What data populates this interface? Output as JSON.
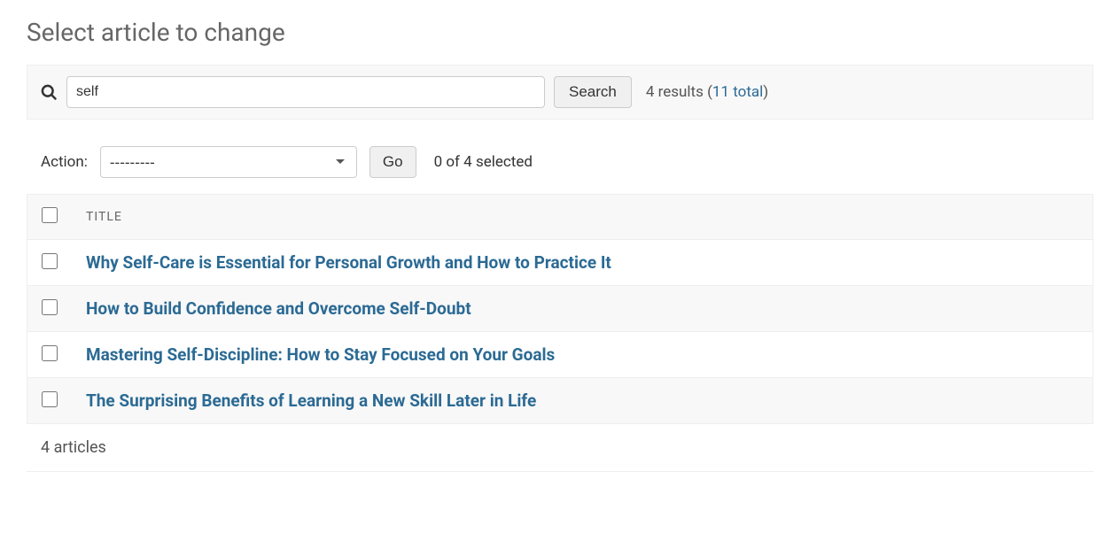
{
  "page": {
    "title": "Select article to change"
  },
  "search": {
    "value": "self",
    "button_label": "Search",
    "results_prefix": "4 results (",
    "total_link": "11 total",
    "results_suffix": ")"
  },
  "action": {
    "label": "Action:",
    "placeholder": "---------",
    "go_label": "Go",
    "selection_count": "0 of 4 selected"
  },
  "table": {
    "header_title": "TITLE",
    "rows": [
      {
        "title": "Why Self-Care is Essential for Personal Growth and How to Practice It"
      },
      {
        "title": "How to Build Confidence and Overcome Self-Doubt"
      },
      {
        "title": "Mastering Self-Discipline: How to Stay Focused on Your Goals"
      },
      {
        "title": "The Surprising Benefits of Learning a New Skill Later in Life"
      }
    ]
  },
  "footer": {
    "count": "4 articles"
  }
}
